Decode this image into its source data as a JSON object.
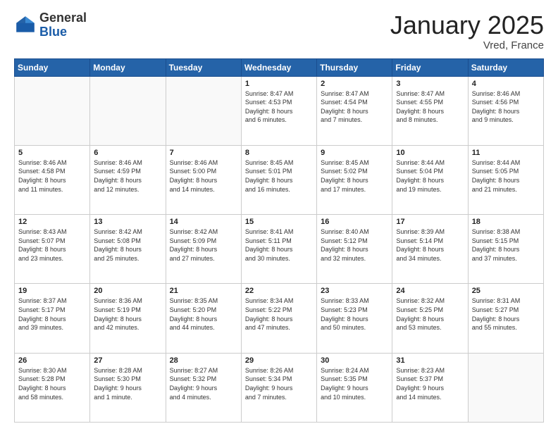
{
  "header": {
    "logo_general": "General",
    "logo_blue": "Blue",
    "title": "January 2025",
    "subtitle": "Vred, France"
  },
  "weekdays": [
    "Sunday",
    "Monday",
    "Tuesday",
    "Wednesday",
    "Thursday",
    "Friday",
    "Saturday"
  ],
  "weeks": [
    [
      {
        "day": "",
        "info": ""
      },
      {
        "day": "",
        "info": ""
      },
      {
        "day": "",
        "info": ""
      },
      {
        "day": "1",
        "info": "Sunrise: 8:47 AM\nSunset: 4:53 PM\nDaylight: 8 hours\nand 6 minutes."
      },
      {
        "day": "2",
        "info": "Sunrise: 8:47 AM\nSunset: 4:54 PM\nDaylight: 8 hours\nand 7 minutes."
      },
      {
        "day": "3",
        "info": "Sunrise: 8:47 AM\nSunset: 4:55 PM\nDaylight: 8 hours\nand 8 minutes."
      },
      {
        "day": "4",
        "info": "Sunrise: 8:46 AM\nSunset: 4:56 PM\nDaylight: 8 hours\nand 9 minutes."
      }
    ],
    [
      {
        "day": "5",
        "info": "Sunrise: 8:46 AM\nSunset: 4:58 PM\nDaylight: 8 hours\nand 11 minutes."
      },
      {
        "day": "6",
        "info": "Sunrise: 8:46 AM\nSunset: 4:59 PM\nDaylight: 8 hours\nand 12 minutes."
      },
      {
        "day": "7",
        "info": "Sunrise: 8:46 AM\nSunset: 5:00 PM\nDaylight: 8 hours\nand 14 minutes."
      },
      {
        "day": "8",
        "info": "Sunrise: 8:45 AM\nSunset: 5:01 PM\nDaylight: 8 hours\nand 16 minutes."
      },
      {
        "day": "9",
        "info": "Sunrise: 8:45 AM\nSunset: 5:02 PM\nDaylight: 8 hours\nand 17 minutes."
      },
      {
        "day": "10",
        "info": "Sunrise: 8:44 AM\nSunset: 5:04 PM\nDaylight: 8 hours\nand 19 minutes."
      },
      {
        "day": "11",
        "info": "Sunrise: 8:44 AM\nSunset: 5:05 PM\nDaylight: 8 hours\nand 21 minutes."
      }
    ],
    [
      {
        "day": "12",
        "info": "Sunrise: 8:43 AM\nSunset: 5:07 PM\nDaylight: 8 hours\nand 23 minutes."
      },
      {
        "day": "13",
        "info": "Sunrise: 8:42 AM\nSunset: 5:08 PM\nDaylight: 8 hours\nand 25 minutes."
      },
      {
        "day": "14",
        "info": "Sunrise: 8:42 AM\nSunset: 5:09 PM\nDaylight: 8 hours\nand 27 minutes."
      },
      {
        "day": "15",
        "info": "Sunrise: 8:41 AM\nSunset: 5:11 PM\nDaylight: 8 hours\nand 30 minutes."
      },
      {
        "day": "16",
        "info": "Sunrise: 8:40 AM\nSunset: 5:12 PM\nDaylight: 8 hours\nand 32 minutes."
      },
      {
        "day": "17",
        "info": "Sunrise: 8:39 AM\nSunset: 5:14 PM\nDaylight: 8 hours\nand 34 minutes."
      },
      {
        "day": "18",
        "info": "Sunrise: 8:38 AM\nSunset: 5:15 PM\nDaylight: 8 hours\nand 37 minutes."
      }
    ],
    [
      {
        "day": "19",
        "info": "Sunrise: 8:37 AM\nSunset: 5:17 PM\nDaylight: 8 hours\nand 39 minutes."
      },
      {
        "day": "20",
        "info": "Sunrise: 8:36 AM\nSunset: 5:19 PM\nDaylight: 8 hours\nand 42 minutes."
      },
      {
        "day": "21",
        "info": "Sunrise: 8:35 AM\nSunset: 5:20 PM\nDaylight: 8 hours\nand 44 minutes."
      },
      {
        "day": "22",
        "info": "Sunrise: 8:34 AM\nSunset: 5:22 PM\nDaylight: 8 hours\nand 47 minutes."
      },
      {
        "day": "23",
        "info": "Sunrise: 8:33 AM\nSunset: 5:23 PM\nDaylight: 8 hours\nand 50 minutes."
      },
      {
        "day": "24",
        "info": "Sunrise: 8:32 AM\nSunset: 5:25 PM\nDaylight: 8 hours\nand 53 minutes."
      },
      {
        "day": "25",
        "info": "Sunrise: 8:31 AM\nSunset: 5:27 PM\nDaylight: 8 hours\nand 55 minutes."
      }
    ],
    [
      {
        "day": "26",
        "info": "Sunrise: 8:30 AM\nSunset: 5:28 PM\nDaylight: 8 hours\nand 58 minutes."
      },
      {
        "day": "27",
        "info": "Sunrise: 8:28 AM\nSunset: 5:30 PM\nDaylight: 9 hours\nand 1 minute."
      },
      {
        "day": "28",
        "info": "Sunrise: 8:27 AM\nSunset: 5:32 PM\nDaylight: 9 hours\nand 4 minutes."
      },
      {
        "day": "29",
        "info": "Sunrise: 8:26 AM\nSunset: 5:34 PM\nDaylight: 9 hours\nand 7 minutes."
      },
      {
        "day": "30",
        "info": "Sunrise: 8:24 AM\nSunset: 5:35 PM\nDaylight: 9 hours\nand 10 minutes."
      },
      {
        "day": "31",
        "info": "Sunrise: 8:23 AM\nSunset: 5:37 PM\nDaylight: 9 hours\nand 14 minutes."
      },
      {
        "day": "",
        "info": ""
      }
    ]
  ]
}
